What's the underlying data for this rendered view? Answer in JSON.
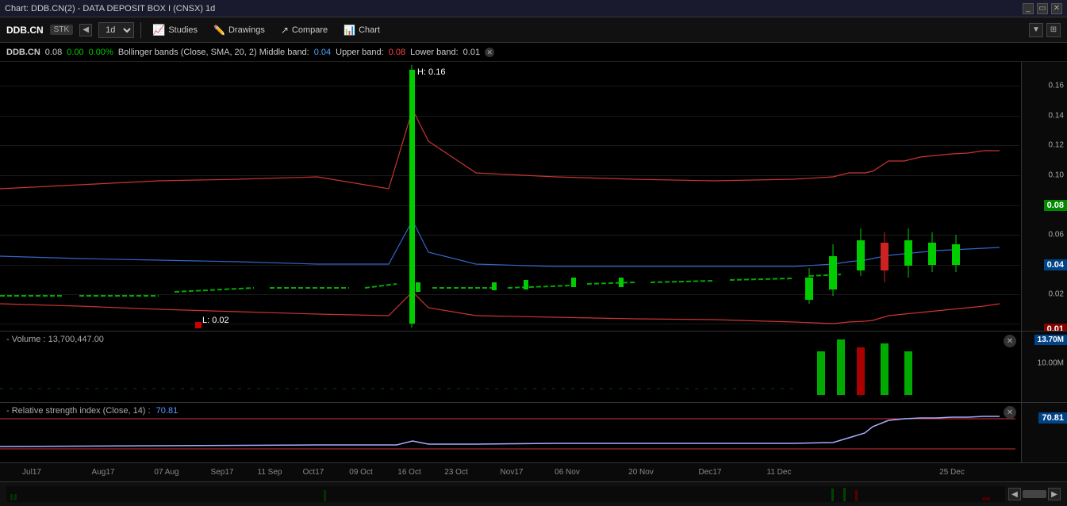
{
  "titleBar": {
    "title": "Chart: DDB.CN(2) - DATA DEPOSIT BOX I (CNSX) 1d",
    "buttons": [
      "minimize",
      "restore",
      "close"
    ]
  },
  "toolbar": {
    "ticker": "DDB.CN",
    "tickerType": "STK",
    "interval": "1d",
    "studies_label": "Studies",
    "drawings_label": "Drawings",
    "compare_label": "Compare",
    "chart_label": "Chart"
  },
  "infoBar": {
    "ticker": "DDB.CN",
    "price": "0.08",
    "change": "0.00",
    "changePct": "0.00%",
    "bb_desc": "Bollinger bands (Close, SMA, 20, 2) Middle band:",
    "bb_middle": "0.04",
    "bb_upper_label": "Upper band:",
    "bb_upper": "0.08",
    "bb_lower_label": "Lower band:",
    "bb_lower": "0.01"
  },
  "mainChart": {
    "highLabel": "H: 0.16",
    "lowLabel": "L: 0.02",
    "priceScale": [
      0.16,
      0.14,
      0.12,
      0.1,
      0.08,
      0.06,
      0.04,
      0.02
    ],
    "currentPrice": "0.08",
    "bbMiddle": "0.04",
    "bbLower": "0.01"
  },
  "volumePanel": {
    "label": "- Volume",
    "value": "13,700,447.00",
    "scaleLabels": [
      "13.70M",
      "10.00M"
    ]
  },
  "rsiPanel": {
    "label": "- Relative strength index (Close, 14) :",
    "value": "70.81"
  },
  "timeAxis": {
    "labels": [
      "Jul17",
      "Aug17",
      "07 Aug",
      "Sep17",
      "11 Sep",
      "Oct17",
      "09 Oct",
      "16 Oct",
      "23 Oct",
      "Nov17",
      "06 Nov",
      "20 Nov",
      "Dec17",
      "11 Dec",
      "25 Dec"
    ]
  }
}
